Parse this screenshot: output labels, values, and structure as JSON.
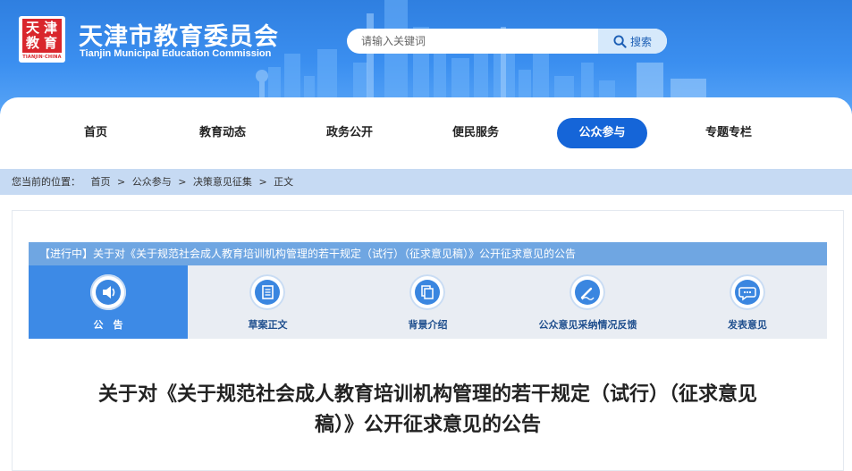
{
  "header": {
    "logo_chars": [
      "天",
      "津",
      "教",
      "育"
    ],
    "logo_caption": "TIANJIN·CHINA",
    "title": "天津市教育委员会",
    "subtitle": "Tianjin Municipal Education Commission",
    "brand_color": "#2f7fe0"
  },
  "search": {
    "placeholder": "请输入关键词",
    "button_label": "搜索",
    "icon": "search-icon"
  },
  "nav": {
    "items": [
      {
        "label": "首页"
      },
      {
        "label": "教育动态"
      },
      {
        "label": "政务公开"
      },
      {
        "label": "便民服务"
      },
      {
        "label": "公众参与",
        "active": true
      },
      {
        "label": "专题专栏"
      }
    ],
    "active_color": "#1565d8"
  },
  "breadcrumb": {
    "prefix": "您当前的位置：",
    "items": [
      "首页",
      "公众参与",
      "决策意见征集",
      "正文"
    ],
    "separator": ">"
  },
  "notice": {
    "status": "【进行中】",
    "text": "关于对《关于规范社会成人教育培训机构管理的若干规定（试行）（征求意见稿）》公开征求意见的公告"
  },
  "tabs": [
    {
      "label": "公　告",
      "icon": "speaker-icon",
      "active": true
    },
    {
      "label": "草案正文",
      "icon": "document-icon"
    },
    {
      "label": "背景介绍",
      "icon": "copy-icon"
    },
    {
      "label": "公众意见采纳情况反馈",
      "icon": "pen-icon"
    },
    {
      "label": "发表意见",
      "icon": "chat-icon"
    }
  ],
  "article": {
    "title_line1": "关于对《关于规范社会成人教育培训机构管理的若干规定（试行）（征求意见",
    "title_line2": "稿）》公开征求意见的公告"
  }
}
